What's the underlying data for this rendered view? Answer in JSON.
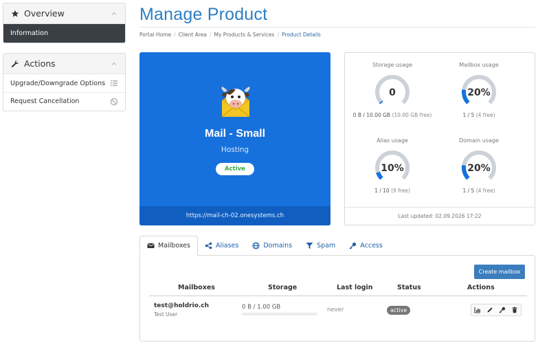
{
  "sidebar": {
    "overview": {
      "title": "Overview",
      "active_item": "Information"
    },
    "actions": {
      "title": "Actions",
      "items": [
        {
          "label": "Upgrade/Downgrade Options",
          "icon": "list-icon"
        },
        {
          "label": "Request Cancellation",
          "icon": "ban-icon"
        }
      ]
    }
  },
  "header": {
    "title": "Manage Product",
    "breadcrumb": [
      "Portal Home",
      "Client Area",
      "My Products & Services",
      "Product Details"
    ]
  },
  "product": {
    "name": "Mail - Small",
    "type": "Hosting",
    "status": "Active",
    "url": "https://mail-ch-02.onesystems.ch",
    "logo_icon": "cow-mail-logo"
  },
  "usage": {
    "gauges": [
      {
        "label": "Storage usage",
        "value": "0",
        "fraction": 0.0,
        "sub": "0 B / 10.00 GB",
        "sub_muted": "(10.00 GB free)"
      },
      {
        "label": "Mailbox usage",
        "value": "20%",
        "fraction": 0.2,
        "sub": "1 / 5",
        "sub_muted": "(4 free)"
      },
      {
        "label": "Alias usage",
        "value": "10%",
        "fraction": 0.1,
        "sub": "1 / 10",
        "sub_muted": "(9 free)"
      },
      {
        "label": "Domain usage",
        "value": "20%",
        "fraction": 0.2,
        "sub": "1 / 5",
        "sub_muted": "(4 free)"
      }
    ],
    "last_updated": "Last updated: 02.09.2026 17:22"
  },
  "tabs": [
    {
      "label": "Mailboxes",
      "icon": "envelope-icon",
      "active": true
    },
    {
      "label": "Aliases",
      "icon": "share-icon"
    },
    {
      "label": "Domains",
      "icon": "globe-icon"
    },
    {
      "label": "Spam",
      "icon": "filter-icon"
    },
    {
      "label": "Access",
      "icon": "key-icon"
    }
  ],
  "mailboxes": {
    "create_button": "Create mailbox",
    "columns": [
      "Mailboxes",
      "Storage",
      "Last login",
      "Status",
      "Actions"
    ],
    "rows": [
      {
        "email": "test@holdrio.ch",
        "name": "Test User",
        "storage": "0 B / 1.00 GB",
        "storage_fraction": 0.0,
        "last_login": "never",
        "status": "active"
      }
    ],
    "row_actions": [
      "chart-icon",
      "pencil-icon",
      "key-icon",
      "trash-icon"
    ]
  },
  "colors": {
    "title": "#2d7ec4",
    "product_bg": "#1671dd",
    "gauge_fill": "#1671dd",
    "gauge_track": "#cdd2d8",
    "active_green": "#3aa64b",
    "sidebar_active_bg": "#3a3f44",
    "primary_button": "#3c7ebd"
  }
}
